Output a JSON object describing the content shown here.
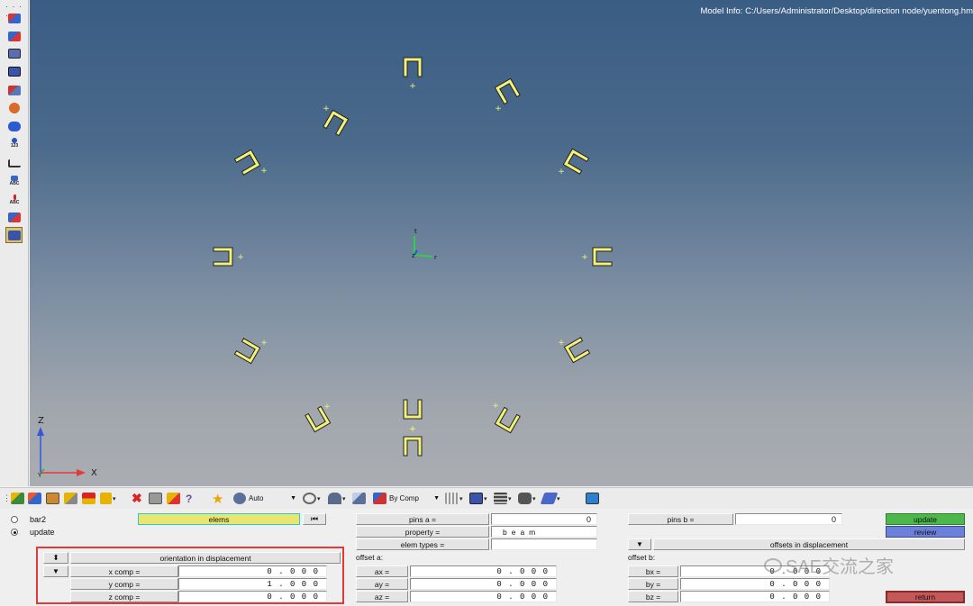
{
  "viewport": {
    "model_info": "Model Info: C:/Users/Administrator/Desktop/direction node/yuentong.hm",
    "background_top": "#3a5d84",
    "background_bottom": "#aaadb1",
    "beam_color": "#f2f27a",
    "node_color": "#f2f27a",
    "local_axis": {
      "x_label": "r",
      "y_label": "t",
      "z_label": "z"
    },
    "global_triad": {
      "z_label": "Z",
      "y_label": "Y",
      "x_label": "X"
    }
  },
  "left_toolbar": {
    "icons": [
      {
        "name": "component-icon",
        "caption": ""
      },
      {
        "name": "display-elements-icon",
        "caption": ""
      },
      {
        "name": "mask-icon",
        "caption": ""
      },
      {
        "name": "unmask-icon",
        "caption": ""
      },
      {
        "name": "find-icon",
        "caption": ""
      },
      {
        "name": "spherical-clip-icon",
        "caption": ""
      },
      {
        "name": "binoculars-icon",
        "caption": ""
      },
      {
        "name": "numbers-icon",
        "caption": "123"
      },
      {
        "name": "distance-icon",
        "caption": ""
      },
      {
        "name": "label-abc-icon",
        "caption": "ABC"
      },
      {
        "name": "label-abc-down-icon",
        "caption": "ABC"
      },
      {
        "name": "edit-label-icon",
        "caption": ""
      },
      {
        "name": "beam-section-icon",
        "caption": ""
      }
    ]
  },
  "h_toolbar": {
    "auto_combo": "Auto",
    "color_combo": "By Comp"
  },
  "panel": {
    "radios": [
      {
        "label": "bar2",
        "selected": false
      },
      {
        "label": "update",
        "selected": true
      }
    ],
    "elems_label": "elems",
    "skip_icon": "skip-to-start-icon",
    "orientation_label": "orientation in displacement",
    "orient_fields": [
      {
        "label": "x comp =",
        "value": "0 . 0 0 0"
      },
      {
        "label": "y comp =",
        "value": "1 . 0 0 0"
      },
      {
        "label": "z comp =",
        "value": "0 . 0 0 0"
      }
    ],
    "pins_a_label": "pins a =",
    "pins_a_value": "0",
    "property_label": "property =",
    "property_value": "beam",
    "elem_types_label": "elem types =",
    "elem_types_value": "",
    "offset_a_label": "offset a:",
    "offset_a_fields": [
      {
        "label": "ax =",
        "value": "0 . 0 0 0"
      },
      {
        "label": "ay =",
        "value": "0 . 0 0 0"
      },
      {
        "label": "az =",
        "value": "0 . 0 0 0"
      }
    ],
    "pins_b_label": "pins b =",
    "pins_b_value": "0",
    "offsets_disp_label": "offsets in displacement",
    "offset_b_label": "offset b:",
    "offset_b_fields": [
      {
        "label": "bx =",
        "value": "0 . 0 0 0"
      },
      {
        "label": "by =",
        "value": "0 . 0 0 0"
      },
      {
        "label": "bz =",
        "value": "0 . 0 0 0"
      }
    ],
    "update_label": "update",
    "review_label": "review",
    "return_label": "return",
    "watermark": "SAE交流之家"
  }
}
